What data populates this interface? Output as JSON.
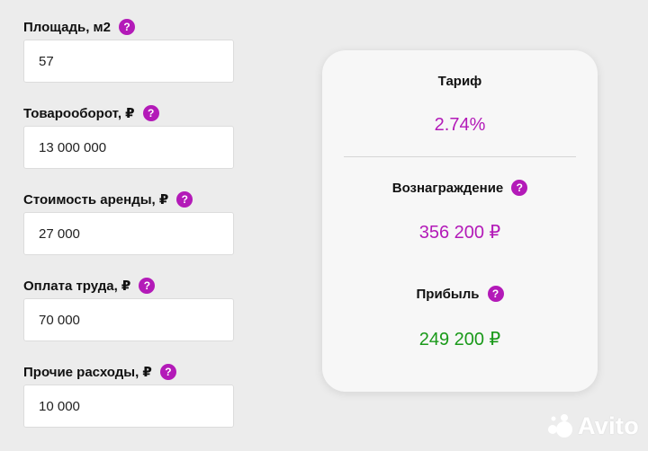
{
  "fields": [
    {
      "label": "Площадь, м2",
      "value": "57"
    },
    {
      "label": "Товарооборот, ₽",
      "value": "13 000 000"
    },
    {
      "label": "Стоимость аренды, ₽",
      "value": "27 000"
    },
    {
      "label": "Оплата труда, ₽",
      "value": "70 000"
    },
    {
      "label": "Прочие расходы, ₽",
      "value": "10 000"
    }
  ],
  "help_glyph": "?",
  "results": {
    "tariff": {
      "label": "Тариф",
      "value": "2.74%"
    },
    "reward": {
      "label": "Вознаграждение",
      "value": "356 200 ₽"
    },
    "profit": {
      "label": "Прибыль",
      "value": "249 200 ₽"
    }
  },
  "watermark": "Avito",
  "colors": {
    "accent_purple": "#b31ab8",
    "profit_green": "#1a9a1a",
    "background": "#ececec",
    "card": "#f7f7f7"
  }
}
